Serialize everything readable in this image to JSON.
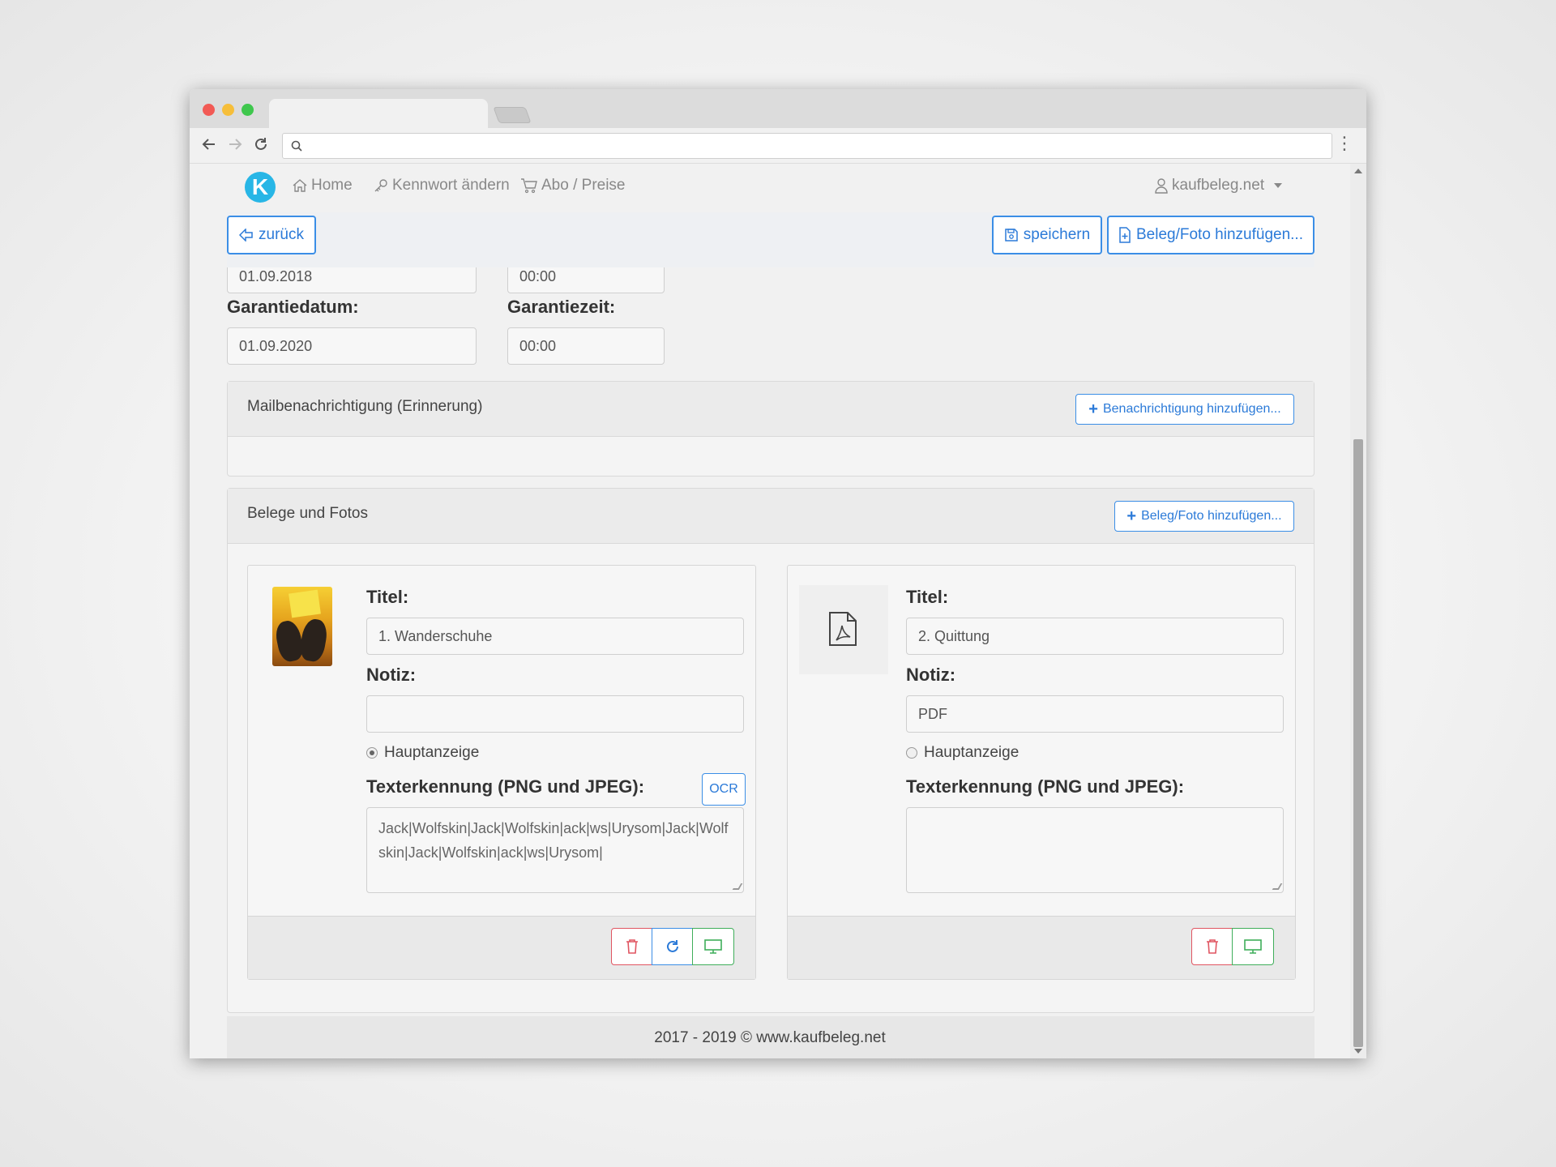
{
  "nav": {
    "home": "Home",
    "password": "Kennwort ändern",
    "abo": "Abo / Preise",
    "user": "kaufbeleg.net",
    "logo_letter": "K"
  },
  "actions": {
    "back": "zurück",
    "save": "speichern",
    "add_doc": "Beleg/Foto hinzufügen..."
  },
  "purchase": {
    "date": "01.09.2018",
    "time": "00:00"
  },
  "warranty": {
    "date_label": "Garantiedatum:",
    "date_value": "01.09.2020",
    "time_label": "Garantiezeit:",
    "time_value": "00:00"
  },
  "mail": {
    "title": "Mailbenachrichtigung (Erinnerung)",
    "add_button": "Benachrichtigung hinzufügen..."
  },
  "docs": {
    "title": "Belege und Fotos",
    "add_button": "Beleg/Foto hinzufügen...",
    "items": [
      {
        "title_label": "Titel:",
        "title_value": "1. Wanderschuhe",
        "note_label": "Notiz:",
        "note_value": "",
        "radio_label": "Hauptanzeige",
        "ocr_label": "Texterkennung (PNG und JPEG):",
        "ocr_button": "OCR",
        "ocr_text": "Jack|Wolfskin|Jack|Wolfskin|ack|ws|Urysom|Jack|Wolfskin|Jack|Wolfskin|ack|ws|Urysom|"
      },
      {
        "title_label": "Titel:",
        "title_value": "2. Quittung",
        "note_label": "Notiz:",
        "note_value": "PDF",
        "radio_label": "Hauptanzeige",
        "ocr_label": "Texterkennung (PNG und JPEG):",
        "ocr_text": ""
      }
    ]
  },
  "footer": {
    "text": "2017 - 2019 © www.kaufbeleg.net"
  },
  "colors": {
    "primary": "#3b8ee6",
    "danger": "#e05561",
    "success": "#3fae5a",
    "logo": "#28b6e6"
  }
}
